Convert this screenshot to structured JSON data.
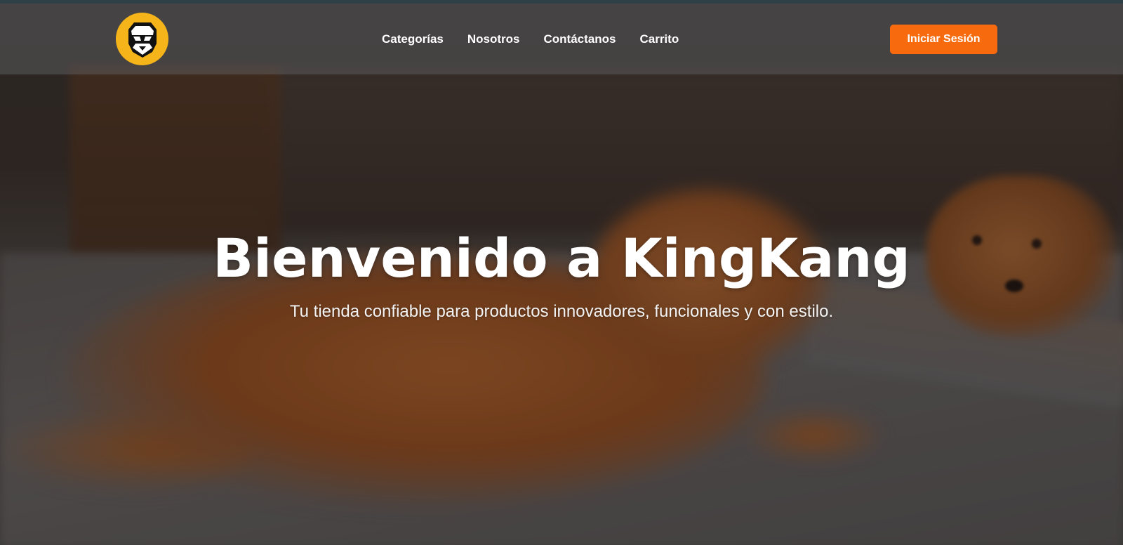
{
  "header": {
    "logo_icon": "gorilla-head-icon",
    "nav": [
      {
        "label": "Categorías"
      },
      {
        "label": "Nosotros"
      },
      {
        "label": "Contáctanos"
      },
      {
        "label": "Carrito"
      }
    ],
    "login_label": "Iniciar Sesión"
  },
  "hero": {
    "title": "Bienvenido a KingKang",
    "subtitle": "Tu tienda confiable para productos innovadores, funcionales y con estilo."
  },
  "colors": {
    "accent": "#f76b0e",
    "logo_bg": "#f5b41a"
  }
}
